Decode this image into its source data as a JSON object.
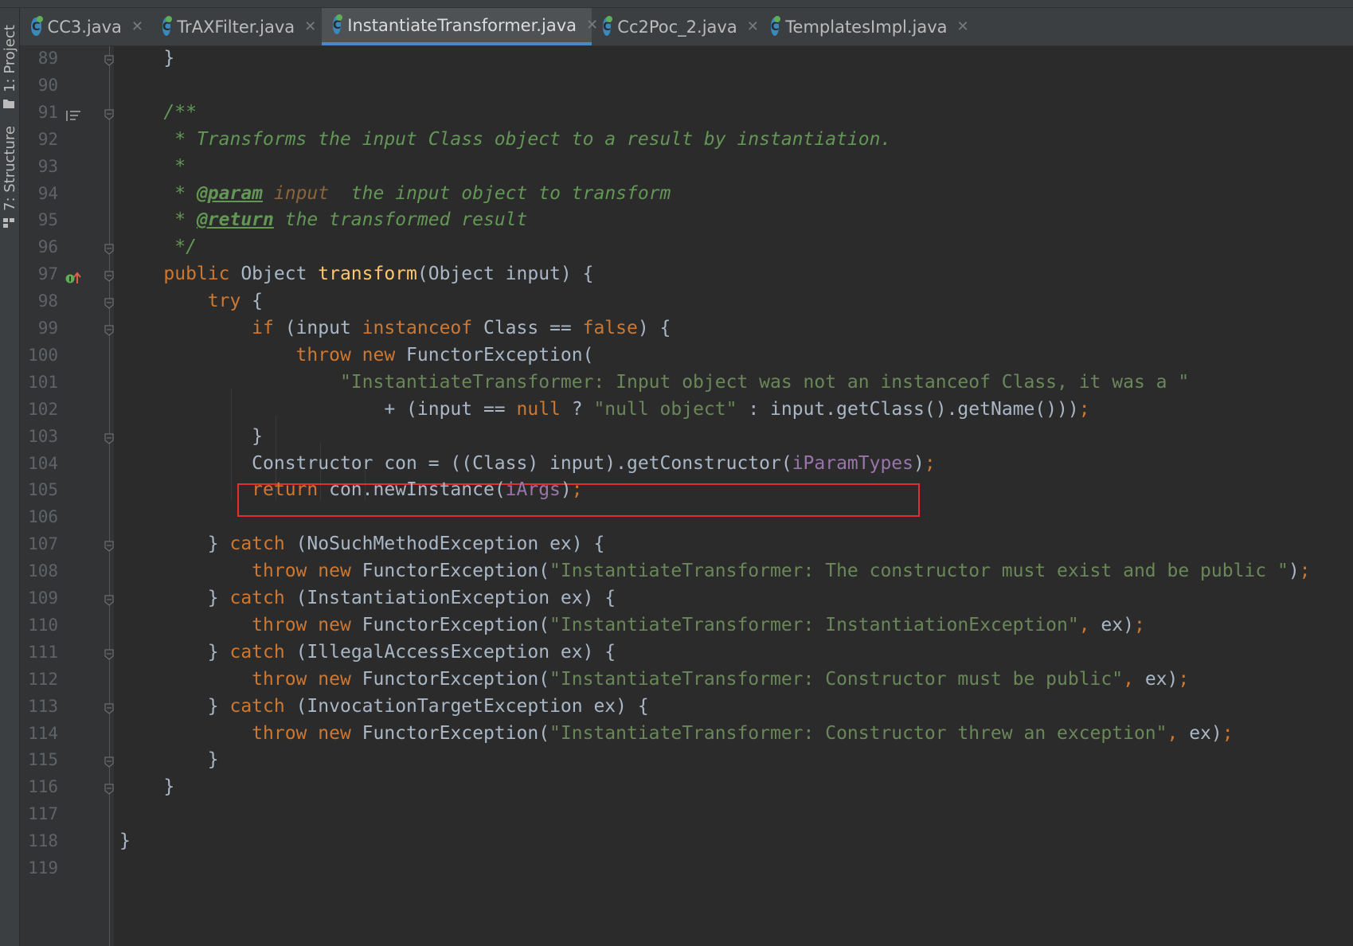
{
  "sidebar": {
    "project_label": "1: Project",
    "structure_label": "7: Structure"
  },
  "tabs": [
    {
      "label": "CC3.java",
      "active": false
    },
    {
      "label": "TrAXFilter.java",
      "active": false
    },
    {
      "label": "InstantiateTransformer.java",
      "active": true
    },
    {
      "label": "Cc2Poc_2.java",
      "active": false
    },
    {
      "label": "TemplatesImpl.java",
      "active": false
    }
  ],
  "editor": {
    "lines": [
      {
        "n": "89",
        "t": [
          [
            "p",
            "    }"
          ]
        ]
      },
      {
        "n": "90",
        "t": []
      },
      {
        "n": "91",
        "t": [
          [
            "cmt",
            "    /**"
          ]
        ]
      },
      {
        "n": "92",
        "t": [
          [
            "cmt",
            "     * Transforms the input Class object to a result by instantiation."
          ]
        ]
      },
      {
        "n": "93",
        "t": [
          [
            "cmt",
            "     *"
          ]
        ]
      },
      {
        "n": "94",
        "t": [
          [
            "cmt",
            "     * "
          ],
          [
            "tag",
            "@param"
          ],
          [
            "cmt",
            " "
          ],
          [
            "pname",
            "input"
          ],
          [
            "cmt",
            "  the input object to transform"
          ]
        ]
      },
      {
        "n": "95",
        "t": [
          [
            "cmt",
            "     * "
          ],
          [
            "tag",
            "@return"
          ],
          [
            "cmt",
            " the transformed result"
          ]
        ]
      },
      {
        "n": "96",
        "t": [
          [
            "cmt",
            "     */"
          ]
        ]
      },
      {
        "n": "97",
        "t": [
          [
            "kw",
            "    public "
          ],
          [
            "p",
            "Object "
          ],
          [
            "fn",
            "transform"
          ],
          [
            "p",
            "(Object input) {"
          ]
        ]
      },
      {
        "n": "98",
        "t": [
          [
            "kw",
            "        try "
          ],
          [
            "p",
            "{"
          ]
        ]
      },
      {
        "n": "99",
        "t": [
          [
            "kw",
            "            if "
          ],
          [
            "p",
            "(input "
          ],
          [
            "kw",
            "instanceof "
          ],
          [
            "p",
            "Class == "
          ],
          [
            "kw",
            "false"
          ],
          [
            "p",
            ") {"
          ]
        ]
      },
      {
        "n": "100",
        "t": [
          [
            "kw",
            "                throw new "
          ],
          [
            "p",
            "FunctorException("
          ]
        ]
      },
      {
        "n": "101",
        "t": [
          [
            "str",
            "                    \"InstantiateTransformer: Input object was not an instanceof Class, it was a \""
          ]
        ]
      },
      {
        "n": "102",
        "t": [
          [
            "p",
            "                        + (input == "
          ],
          [
            "kw",
            "null "
          ],
          [
            "p",
            "? "
          ],
          [
            "str",
            "\"null object\" "
          ],
          [
            "p",
            ": input.getClass().getName()))"
          ],
          [
            "pun",
            ";"
          ]
        ]
      },
      {
        "n": "103",
        "t": [
          [
            "p",
            "            }"
          ]
        ]
      },
      {
        "n": "104",
        "t": [
          [
            "p",
            "            Constructor con = ((Class) input).getConstructor("
          ],
          [
            "fld",
            "iParamTypes"
          ],
          [
            "p",
            ")"
          ],
          [
            "pun",
            ";"
          ]
        ]
      },
      {
        "n": "105",
        "t": [
          [
            "kw",
            "            return "
          ],
          [
            "p",
            "con.newInstance("
          ],
          [
            "fld",
            "iArgs"
          ],
          [
            "p",
            ")"
          ],
          [
            "pun",
            ";"
          ]
        ]
      },
      {
        "n": "106",
        "t": []
      },
      {
        "n": "107",
        "t": [
          [
            "p",
            "        } "
          ],
          [
            "kw",
            "catch "
          ],
          [
            "p",
            "(NoSuchMethodException ex) {"
          ]
        ]
      },
      {
        "n": "108",
        "t": [
          [
            "kw",
            "            throw new "
          ],
          [
            "p",
            "FunctorException("
          ],
          [
            "str",
            "\"InstantiateTransformer: The constructor must exist and be public \""
          ],
          [
            "p",
            ")"
          ],
          [
            "pun",
            ";"
          ]
        ]
      },
      {
        "n": "109",
        "t": [
          [
            "p",
            "        } "
          ],
          [
            "kw",
            "catch "
          ],
          [
            "p",
            "(InstantiationException ex) {"
          ]
        ]
      },
      {
        "n": "110",
        "t": [
          [
            "kw",
            "            throw new "
          ],
          [
            "p",
            "FunctorException("
          ],
          [
            "str",
            "\"InstantiateTransformer: InstantiationException\""
          ],
          [
            "pun",
            ", "
          ],
          [
            "p",
            "ex)"
          ],
          [
            "pun",
            ";"
          ]
        ]
      },
      {
        "n": "111",
        "t": [
          [
            "p",
            "        } "
          ],
          [
            "kw",
            "catch "
          ],
          [
            "p",
            "(IllegalAccessException ex) {"
          ]
        ]
      },
      {
        "n": "112",
        "t": [
          [
            "kw",
            "            throw new "
          ],
          [
            "p",
            "FunctorException("
          ],
          [
            "str",
            "\"InstantiateTransformer: Constructor must be public\""
          ],
          [
            "pun",
            ", "
          ],
          [
            "p",
            "ex)"
          ],
          [
            "pun",
            ";"
          ]
        ]
      },
      {
        "n": "113",
        "t": [
          [
            "p",
            "        } "
          ],
          [
            "kw",
            "catch "
          ],
          [
            "p",
            "(InvocationTargetException ex) {"
          ]
        ]
      },
      {
        "n": "114",
        "t": [
          [
            "kw",
            "            throw new "
          ],
          [
            "p",
            "FunctorException("
          ],
          [
            "str",
            "\"InstantiateTransformer: Constructor threw an exception\""
          ],
          [
            "pun",
            ", "
          ],
          [
            "p",
            "ex)"
          ],
          [
            "pun",
            ";"
          ]
        ]
      },
      {
        "n": "115",
        "t": [
          [
            "p",
            "        }"
          ]
        ]
      },
      {
        "n": "116",
        "t": [
          [
            "p",
            "    }"
          ]
        ]
      },
      {
        "n": "117",
        "t": []
      },
      {
        "n": "118",
        "t": [
          [
            "p",
            "}"
          ]
        ]
      },
      {
        "n": "119",
        "t": []
      }
    ],
    "highlight_line": "104",
    "gutter_icons": {
      "91": "doc-comment-icon",
      "97": "implements-method-icon"
    },
    "fold_markers": [
      "89",
      "91",
      "96",
      "97",
      "98",
      "99",
      "103",
      "107",
      "109",
      "111",
      "113",
      "115",
      "116"
    ]
  },
  "colors": {
    "keyword": "#cc7832",
    "string": "#6a8759",
    "method": "#ffc66d",
    "field": "#9876aa",
    "comment": "#629755",
    "highlight_box": "#e0312f"
  }
}
